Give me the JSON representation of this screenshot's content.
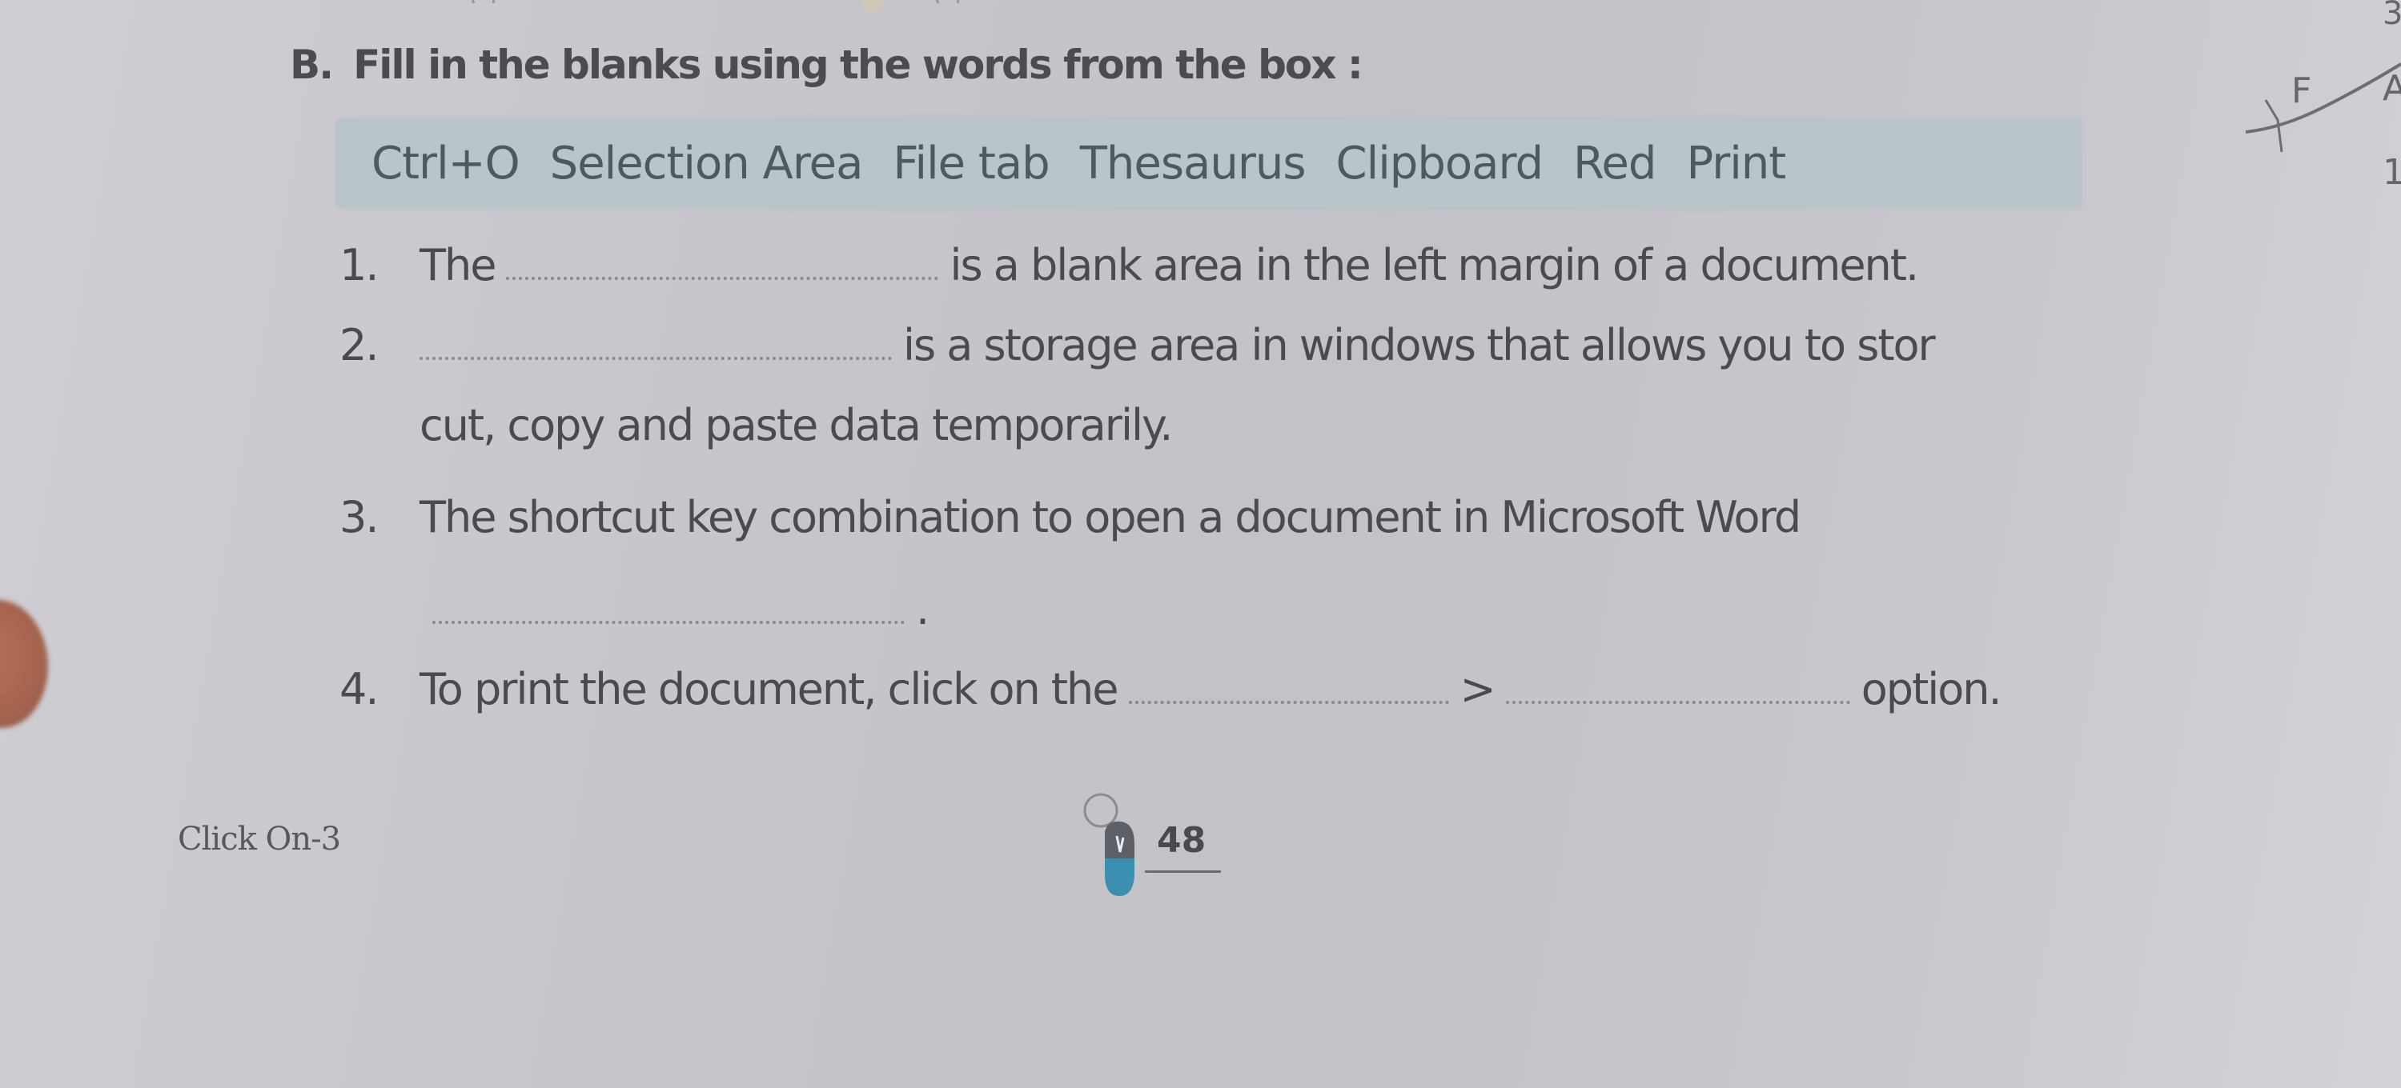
{
  "exercise": {
    "label": "B.",
    "title": "Fill in the blanks using the words from the box :"
  },
  "word_box": {
    "words": [
      "Ctrl+O",
      "Selection Area",
      "File tab",
      "Thesaurus",
      "Clipboard",
      "Red",
      "Print"
    ]
  },
  "questions": [
    {
      "number": "1.",
      "before": "The",
      "after": "is a blank area in the left margin of a document."
    },
    {
      "number": "2.",
      "before": "",
      "after": "is a storage area in windows that allows you to stor",
      "continuation": "cut, copy and paste data temporarily."
    },
    {
      "number": "3.",
      "before": "The shortcut key combination to open a document in Microsoft Word",
      "blank_suffix": "."
    },
    {
      "number": "4.",
      "before": "To print the document, click on the",
      "separator": ">",
      "after": "option."
    }
  ],
  "footer": {
    "book_title": "Click On-3",
    "page_number": "48"
  },
  "margin_marks": {
    "letters": [
      "F",
      "A"
    ],
    "numbers": [
      "3",
      "1"
    ]
  },
  "colors": {
    "box_background": "#b9c4cb",
    "text": "#4b4a4f",
    "mouse_accent": "#3b8fb0"
  }
}
